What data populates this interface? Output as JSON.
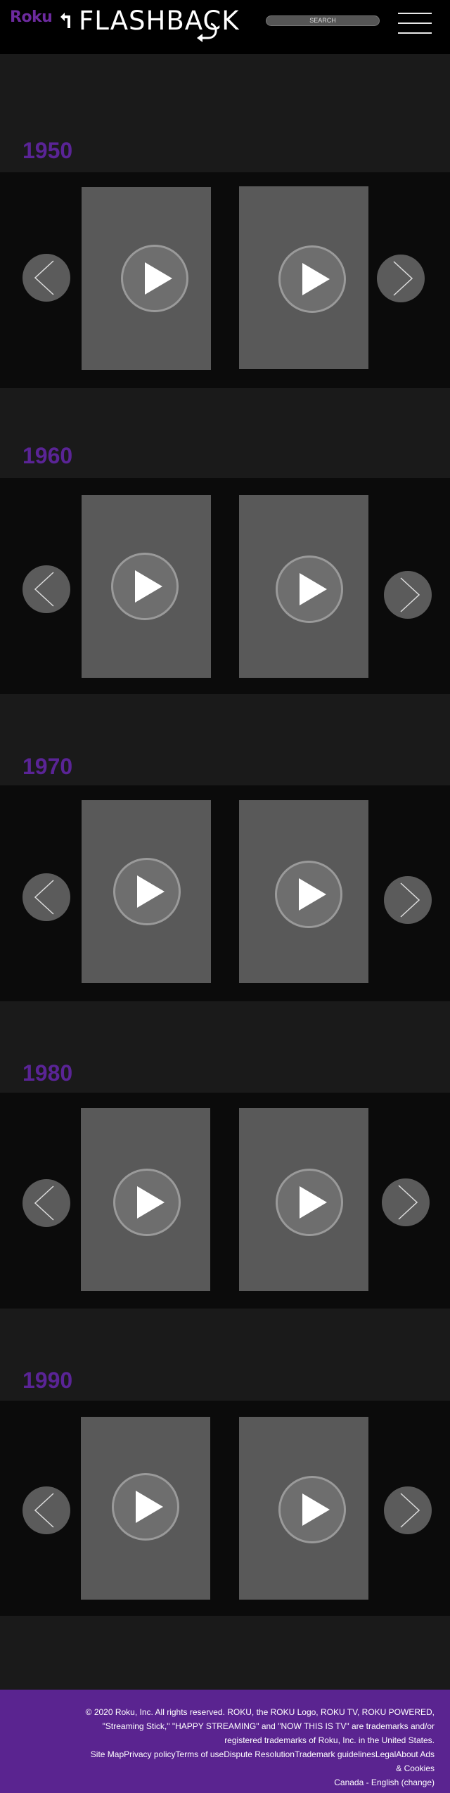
{
  "header": {
    "logo_text": "Roku",
    "title": "FLASHBACK",
    "search_label": "SEARCH"
  },
  "sections": [
    {
      "decade": "1950"
    },
    {
      "decade": "1960"
    },
    {
      "decade": "1970"
    },
    {
      "decade": "1980"
    },
    {
      "decade": "1990"
    }
  ],
  "footer": {
    "copyright": "© 2020 Roku, Inc. All rights reserved. ROKU, the ROKU Logo, ROKU TV, ROKU POWERED, \"Streaming Stick,\" \"HAPPY STREAMING\" and \"NOW THIS IS TV\" are trademarks and/or registered trademarks of Roku, Inc. in the United States.",
    "links": [
      "Site Map",
      "Privacy policy",
      "Terms of use",
      "Dispute Resolution",
      "Trademark guidelines",
      "Legal",
      "About Ads & Cookies"
    ],
    "locale": "Canada - English (change)"
  },
  "colors": {
    "brand_purple": "#5a2490",
    "header_bg": "#000000",
    "band_bg": "#1a1a1a",
    "card_bg": "#595959"
  }
}
